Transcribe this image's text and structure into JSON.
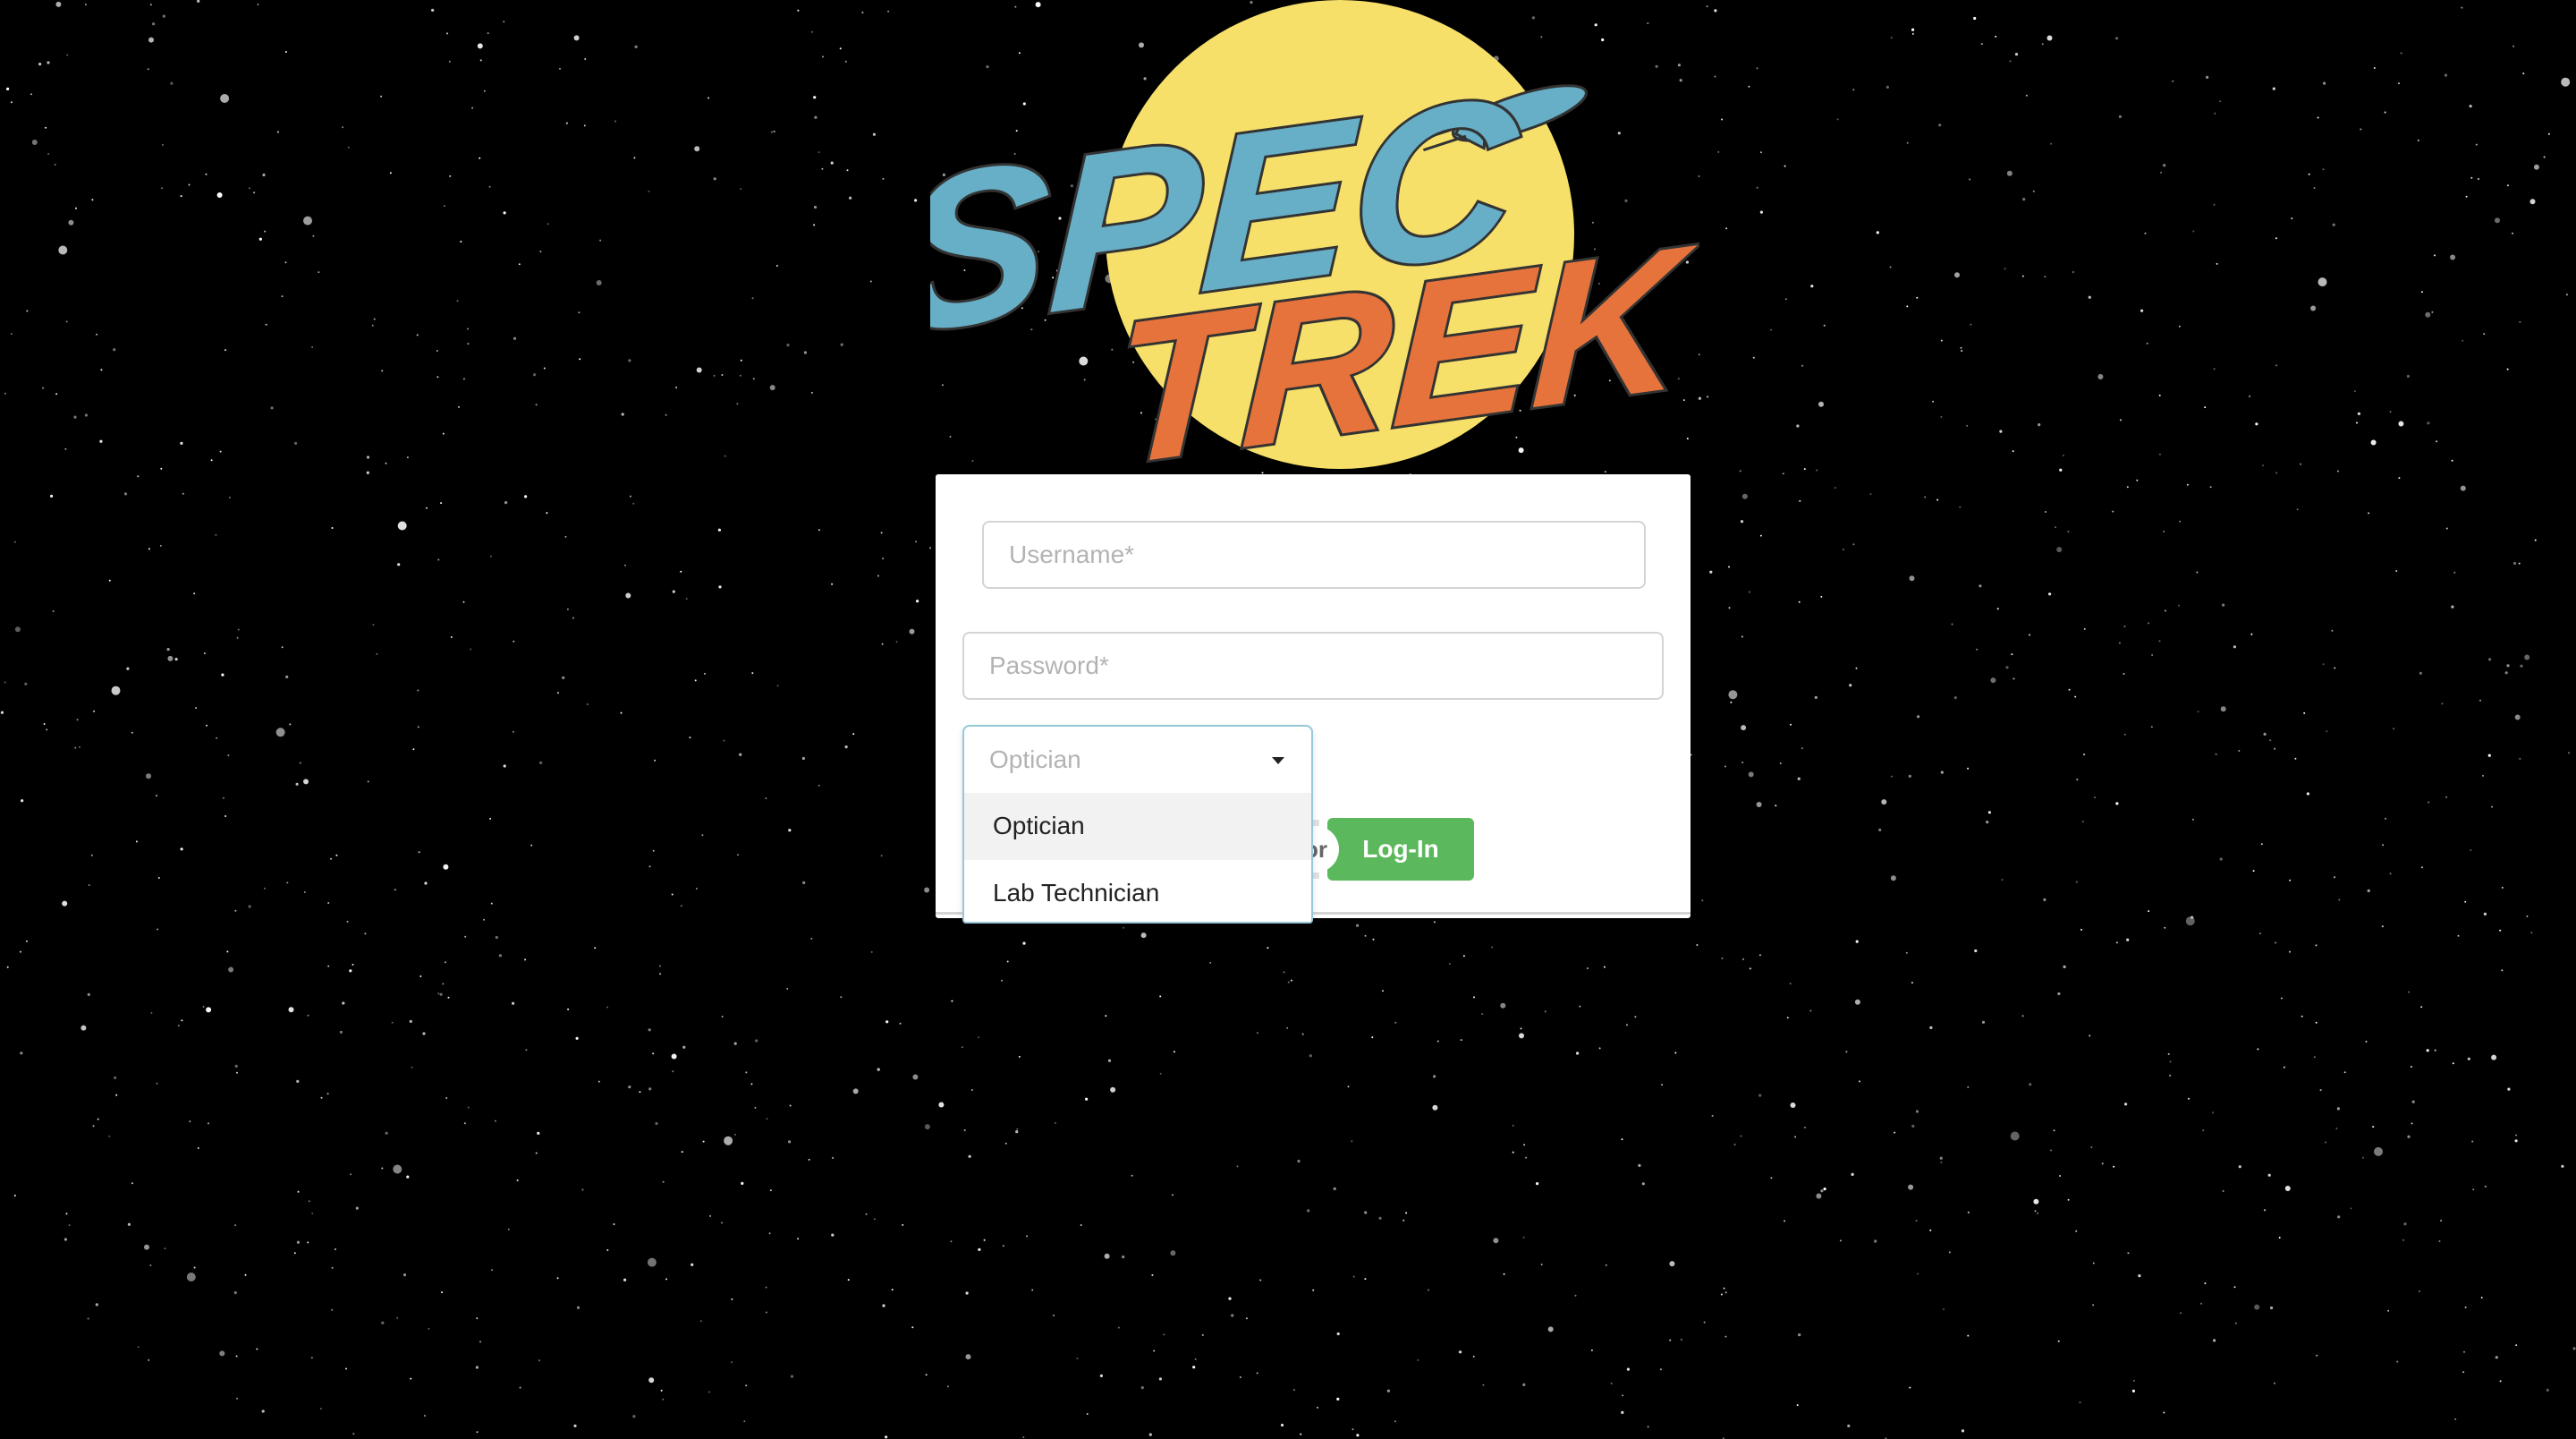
{
  "app": {
    "logo_text_line1": "SPEC",
    "logo_text_line2": "TREK"
  },
  "colors": {
    "background": "#000000",
    "logo_sun": "#f6e06a",
    "logo_spec": "#66afc7",
    "logo_trek": "#e5733b",
    "login_button": "#5cb85c",
    "dropdown_border": "#96c8da"
  },
  "login_form": {
    "username_placeholder": "Username*",
    "password_placeholder": "Password*",
    "role_dropdown": {
      "selected": "Optician",
      "options": [
        "Optician",
        "Lab Technician"
      ]
    },
    "or_label": "or",
    "login_label": "Log-In"
  }
}
